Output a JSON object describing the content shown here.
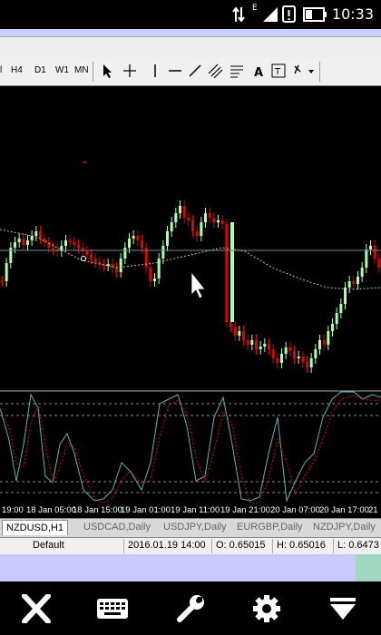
{
  "status_bar": {
    "time": "10:33",
    "signal_label": "E"
  },
  "toolbar": {
    "timeframes": [
      "H4",
      "D1",
      "W1",
      "MN"
    ]
  },
  "chart": {
    "background": "#000000",
    "up_color": "#aaffaa",
    "down_color": "#e00000",
    "ma_color": "#e0c040",
    "hline_color": "#5a8fa0"
  },
  "time_axis": {
    "labels": [
      "19:00",
      "18 Jan 05:00",
      "18 Jan 15:00",
      "19 Jan 01:00",
      "19 Jan 11:00",
      "19 Jan 21:00",
      "20 Jan 07:00",
      "20 Jan 17:00",
      "21"
    ]
  },
  "tabs": [
    "NZDUSD,H1",
    "USDCAD,Daily",
    "USDJPY,Daily",
    "EURGBP,Daily",
    "NZDJPY,Daily"
  ],
  "info": {
    "profile": "Default",
    "datetime": "2016.01.19 14:00",
    "open": "O: 0.65015",
    "high": "H: 0.65016",
    "low": "L: 0.6473"
  },
  "bottom_bar": {
    "buttons": [
      "close-icon",
      "keyboard-icon",
      "wrench-icon",
      "gear-icon",
      "dropdown-icon"
    ]
  }
}
